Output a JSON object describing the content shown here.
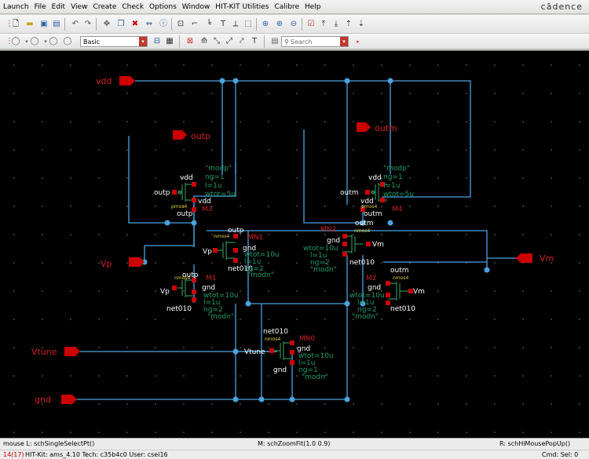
{
  "menubar": {
    "items": [
      "Launch",
      "File",
      "Edit",
      "View",
      "Create",
      "Check",
      "Options",
      "Window",
      "HIT-KIT Utilities",
      "Calibre",
      "Help"
    ],
    "brand": "cādence"
  },
  "toolbar": {
    "filter_value": "Basic",
    "search_placeholder": "Search"
  },
  "schematic": {
    "pins": {
      "vdd": "vdd",
      "outp": "outp",
      "outm": "outm",
      "vp": "Vp",
      "vm": "Vm",
      "vtune": "Vtune",
      "gnd": "gnd"
    },
    "devices": {
      "m3": {
        "inst": "M3",
        "model": "\"modp\"",
        "params": [
          "ng=1",
          "l=1u",
          "wtot=5u"
        ],
        "type": "pmos4"
      },
      "m4": {
        "inst": "M4",
        "model": "\"modp\"",
        "params": [
          "ng=1",
          "l=1u",
          "wtot=5u"
        ],
        "type": "pmos4"
      },
      "mn1": {
        "inst": "MN1",
        "model": "\"modn\"",
        "params": [
          "wtot=10u",
          "l=1u",
          "ng=2"
        ],
        "type": "nmos4"
      },
      "mn2": {
        "inst": "MN2",
        "model": "\"modn\"",
        "params": [
          "wtot=10u",
          "l=1u",
          "ng=2"
        ],
        "type": "nmos4"
      },
      "m1": {
        "inst": "M1",
        "model": "\"modn\"",
        "params": [
          "wtot=10u",
          "l=1u",
          "ng=2"
        ],
        "type": "nmos4"
      },
      "m2": {
        "inst": "M2",
        "model": "\"modn\"",
        "params": [
          "wtot=10u",
          "l=1u",
          "ng=2"
        ],
        "type": "nmos4"
      },
      "mn0": {
        "inst": "MN0",
        "model": "\"modn\"",
        "params": [
          "wtot=10u",
          "l=1u",
          "ng=1"
        ],
        "type": "nmos4"
      }
    },
    "nets": {
      "vdd": "vdd",
      "gnd": "gnd",
      "outp": "outp",
      "outm": "outm",
      "vp": "Vp",
      "vm": "Vm",
      "vtune": "Vtune",
      "net010": "net010"
    }
  },
  "status": {
    "left_mouse": "mouse L: schSingleSelectPt()",
    "middle_mouse": "M: schZoomFit(1.0 0.9)",
    "right_mouse": "R: schHiMousePopUp()",
    "counter": "14(17)",
    "info": "HIT-Kit: ams_4.10  Tech: c35b4c0  User: csei16",
    "cmd": "Cmd: Sel: 0"
  },
  "colors": {
    "canvas": "#000000",
    "wire": "#4aa3df",
    "pin": "#cc0000",
    "label_red": "#d02020",
    "param_green": "#1f9c6a",
    "device_green": "#2e8b57",
    "yellow": "#e0d040"
  }
}
